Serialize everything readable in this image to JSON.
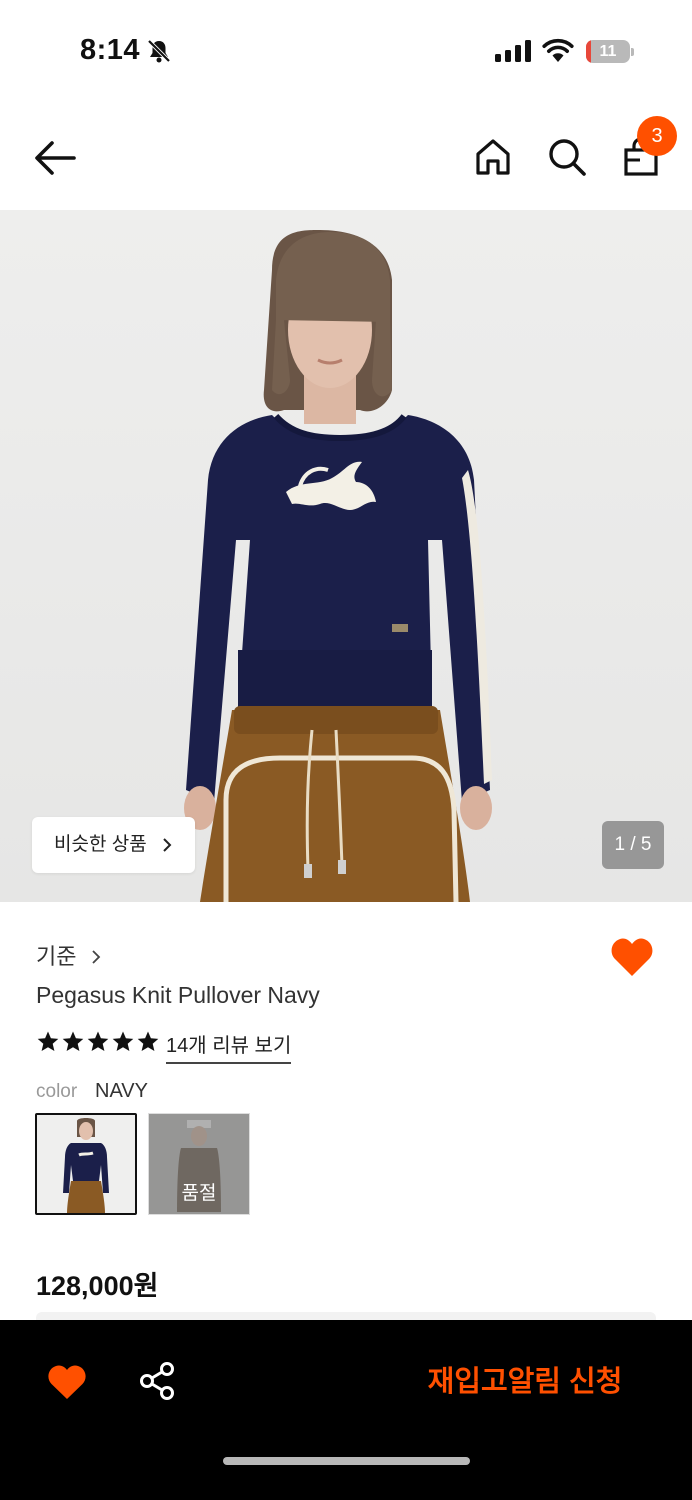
{
  "status_bar": {
    "time": "8:14",
    "battery_level": "11",
    "battery_fraction": 0.11
  },
  "nav": {
    "cart_count": "3"
  },
  "gallery": {
    "similar_label": "비슷한 상품",
    "page_indicator": "1 / 5"
  },
  "product": {
    "brand": "기준",
    "name": "Pegasus Knit Pullover Navy",
    "rating_stars": 5,
    "review_link": "14개 리뷰 보기",
    "color_label": "color",
    "color_value": "NAVY",
    "sold_out_label": "품절",
    "price": "128,000원"
  },
  "bottom_bar": {
    "restock_label": "재입고알림 신청"
  },
  "colors": {
    "accent": "#ff5000",
    "bottom_bar_bg": "#000000",
    "navy": "#1b1f4a",
    "brown": "#8a5a24"
  }
}
